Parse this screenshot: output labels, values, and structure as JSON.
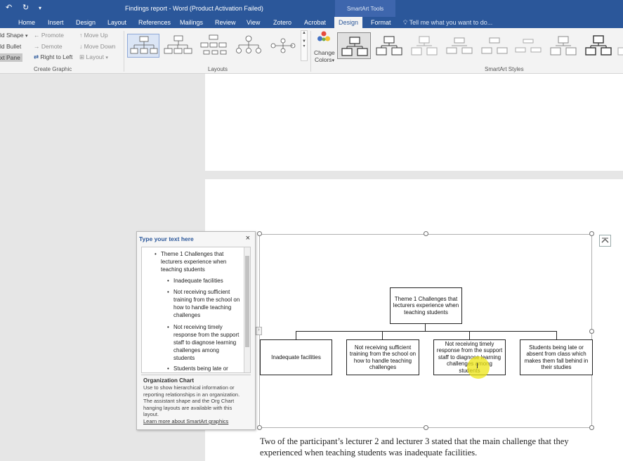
{
  "titlebar": {
    "title": "Findings report - Word (Product Activation Failed)",
    "context_tab_group": "SmartArt Tools"
  },
  "tabs": {
    "home": "Home",
    "insert": "Insert",
    "design": "Design",
    "layout": "Layout",
    "references": "References",
    "mailings": "Mailings",
    "review": "Review",
    "view": "View",
    "zotero": "Zotero",
    "acrobat": "Acrobat",
    "sa_design": "Design",
    "sa_format": "Format",
    "tell_me": "Tell me what you want to do..."
  },
  "ribbon": {
    "create_graphic": {
      "add_shape": "ld Shape",
      "add_bullet": "ld Bullet",
      "text_pane": "xt Pane",
      "promote": "Promote",
      "demote": "Demote",
      "right_to_left": "Right to Left",
      "move_up": "Move Up",
      "move_down": "Move Down",
      "layout": "Layout",
      "group_label": "Create Graphic"
    },
    "layouts_label": "Layouts",
    "change_colors": [
      "Change",
      "Colors"
    ],
    "styles_label": "SmartArt Styles"
  },
  "text_pane": {
    "title": "Type your text here",
    "close": "×",
    "items": [
      "Theme 1 Challenges that lecturers experience when teaching students",
      "Inadequate facilities",
      "Not receiving sufficient training from the school on how to handle teaching challenges",
      "Not receiving timely response from the support staff to diagnose learning challenges among students",
      "Students being late or"
    ],
    "desc_title": "Organization Chart",
    "desc_text": "Use to show hierarchical information or reporting relationships in an organization. The assistant shape and the Org Chart hanging layouts are available with this layout.",
    "link": "Learn more about SmartArt graphics"
  },
  "chart": {
    "root": "Theme 1 Challenges that lecturers experience when teaching students",
    "children": [
      "Inadequate facilities",
      "Not receiving sufficient training from the school on how to handle teaching challenges",
      "Not receiving timely response from the support staff to diagnose learning challenges among students",
      "Students being late or absent from class which makes them fall behind in their studies"
    ]
  },
  "document": {
    "paragraph": "Two of the participant’s lecturer 2 and lecturer 3 stated that the main challenge that they experienced when teaching students was inadequate facilities."
  },
  "icons": [
    "undo-icon",
    "redo-icon",
    "change-colors-icon",
    "lightbulb-icon",
    "collapse-icon"
  ]
}
